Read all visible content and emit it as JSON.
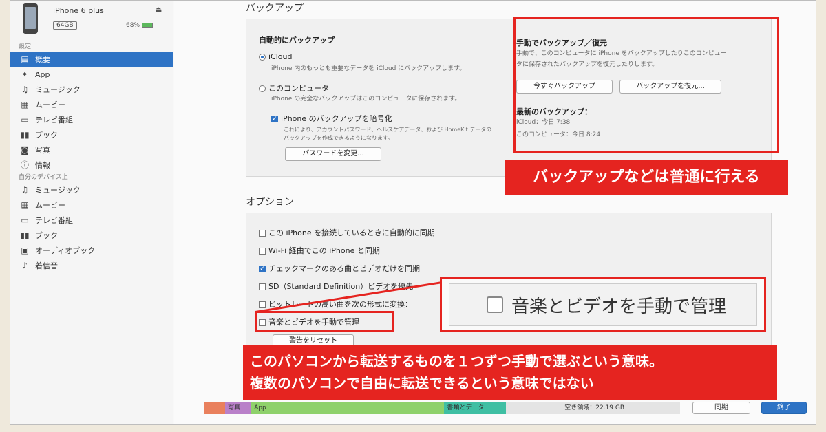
{
  "device": {
    "name": "iPhone 6 plus",
    "capacity": "64GB",
    "battery": "68%"
  },
  "sidebar": {
    "section1": "設定",
    "items": [
      {
        "label": "概要",
        "icon": "summary-icon"
      },
      {
        "label": "App",
        "icon": "apps-icon"
      },
      {
        "label": "ミュージック",
        "icon": "music-icon"
      },
      {
        "label": "ムービー",
        "icon": "movies-icon"
      },
      {
        "label": "テレビ番組",
        "icon": "tv-icon"
      },
      {
        "label": "ブック",
        "icon": "books-icon"
      },
      {
        "label": "写真",
        "icon": "photos-icon"
      },
      {
        "label": "情報",
        "icon": "info-icon"
      }
    ],
    "section2": "自分のデバイス上",
    "items2": [
      {
        "label": "ミュージック",
        "icon": "music-icon"
      },
      {
        "label": "ムービー",
        "icon": "movies-icon"
      },
      {
        "label": "テレビ番組",
        "icon": "tv-icon"
      },
      {
        "label": "ブック",
        "icon": "books-icon"
      },
      {
        "label": "オーディオブック",
        "icon": "audiobooks-icon"
      },
      {
        "label": "着信音",
        "icon": "ringtone-icon"
      }
    ]
  },
  "backup": {
    "heading": "バックアップ",
    "auto_heading": "自動的にバックアップ",
    "icloud_label": "iCloud",
    "icloud_desc": "iPhone 内のもっとも重要なデータを iCloud にバックアップします。",
    "computer_label": "このコンピュータ",
    "computer_desc": "iPhone の完全なバックアップはこのコンピュータに保存されます。",
    "encrypt_label": "iPhone のバックアップを暗号化",
    "encrypt_desc_1": "これにより、アカウントパスワード、ヘルスケアデータ、および HomeKit データの",
    "encrypt_desc_2": "バックアップを作成できるようになります。",
    "change_password": "パスワードを変更...",
    "manual_heading": "手動でバックアップ／復元",
    "manual_desc_1": "手動で、このコンピュータに iPhone をバックアップしたりこのコンピュー",
    "manual_desc_2": "タに保存されたバックアップを復元したりします。",
    "backup_now": "今すぐバックアップ",
    "restore": "バックアップを復元...",
    "latest_heading": "最新のバックアップ：",
    "latest_icloud": "iCloud：今日 7:38",
    "latest_computer": "このコンピュータ：今日 8:24"
  },
  "options": {
    "heading": "オプション",
    "items": [
      {
        "label": "この iPhone を接続しているときに自動的に同期",
        "checked": false
      },
      {
        "label": "Wi-Fi 経由でこの iPhone と同期",
        "checked": false
      },
      {
        "label": "チェックマークのある曲とビデオだけを同期",
        "checked": true
      },
      {
        "label": "SD（Standard Definition）ビデオを優先",
        "checked": false
      },
      {
        "label": "ビットレートの高い曲を次の形式に変換：",
        "checked": false
      },
      {
        "label": "音楽とビデオを手動で管理",
        "checked": false
      }
    ],
    "reset_warnings": "警告をリセット"
  },
  "annotations": {
    "banner_top": "バックアップなどは普通に行える",
    "callout_text": "音楽とビデオを手動で管理",
    "banner_bottom_1": "このパソコンから転送するものを１つずつ手動で選ぶという意味。",
    "banner_bottom_2": "複数のパソコンで自由に転送できるという意味ではない"
  },
  "capacity_bar": {
    "segments": [
      {
        "label": "",
        "color": "#e9805d",
        "fraction": 0.045
      },
      {
        "label": "写真",
        "color": "#b980c9",
        "fraction": 0.055
      },
      {
        "label": "App",
        "color": "#8ed16b",
        "fraction": 0.405
      },
      {
        "label": "書類とデータ",
        "color": "#3fbfa3",
        "fraction": 0.13
      },
      {
        "label": "空き領域：22.19 GB",
        "color": "#e4e4e4",
        "fraction": 0.365
      }
    ]
  },
  "buttons": {
    "sync": "同期",
    "done": "終了"
  },
  "colors": {
    "accent": "#2e73c5",
    "annotation_red": "#e52420"
  }
}
